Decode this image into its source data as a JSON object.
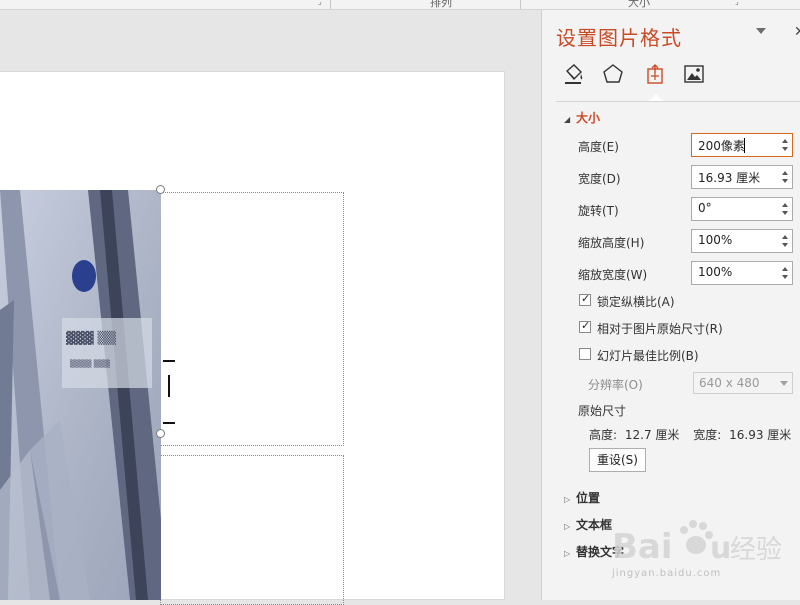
{
  "ribbon": {
    "fragment_1": "排列",
    "fragment_2": "大小"
  },
  "pane": {
    "title": "设置图片格式",
    "tabs": [
      {
        "name": "fill-line",
        "icon": "paint-bucket-icon"
      },
      {
        "name": "effects",
        "icon": "pentagon-icon"
      },
      {
        "name": "size-properties",
        "icon": "size-position-icon",
        "active": true
      },
      {
        "name": "picture",
        "icon": "picture-icon"
      }
    ],
    "size_section": {
      "title": "大小",
      "height_label": "高度(E)",
      "height_value": "200像素",
      "width_label": "宽度(D)",
      "width_value": "16.93 厘米",
      "rotation_label": "旋转(T)",
      "rotation_value": "0°",
      "scale_height_label": "缩放高度(H)",
      "scale_height_value": "100%",
      "scale_width_label": "缩放宽度(W)",
      "scale_width_value": "100%",
      "lock_aspect_label": "锁定纵横比(A)",
      "relative_original_label": "相对于图片原始尺寸(R)",
      "best_scale_label": "幻灯片最佳比例(B)",
      "resolution_label": "分辨率(O)",
      "resolution_value": "640 x 480",
      "original_size_heading": "原始尺寸",
      "original_height_label": "高度:",
      "original_height_value": "12.7 厘米",
      "original_width_label": "宽度:",
      "original_width_value": "16.93 厘米",
      "reset_label": "重设(S)"
    },
    "collapsed_sections": [
      "位置",
      "文本框",
      "替换文字"
    ]
  },
  "colors": {
    "accent": "#c94b26",
    "pane_bg": "#f3f3f3",
    "canvas_bg": "#e6e6e6"
  },
  "watermark": {
    "brand": "Baidu经验",
    "url": "jingyan.baidu.com"
  }
}
